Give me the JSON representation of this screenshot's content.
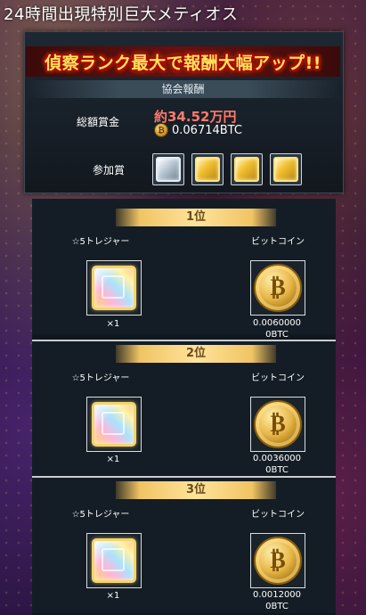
{
  "header": {
    "title": "24時間出現特別巨大メティオス"
  },
  "reward_panel": {
    "banner": "偵察ランク最大で報酬大幅アップ!!",
    "association_label": "協会報酬",
    "total_prize_label": "総額賞金",
    "total_yen": "約34.52万円",
    "total_btc": "0.06714BTC",
    "participation_label": "参加賞",
    "participation_items": [
      "silver-treasure-cube-icon",
      "gold-treasure-cube-icon",
      "gold-treasure-cube-icon",
      "gold-treasure-cube-icon"
    ]
  },
  "ranks": [
    {
      "rank": "1位",
      "item_name": "☆5トレジャー",
      "item_qty": "×1",
      "coin_name": "ビットコイン",
      "btc_amount": "0.0060000 0BTC"
    },
    {
      "rank": "2位",
      "item_name": "☆5トレジャー",
      "item_qty": "×1",
      "coin_name": "ビットコイン",
      "btc_amount": "0.0036000 0BTC"
    },
    {
      "rank": "3位",
      "item_name": "☆5トレジャー",
      "item_qty": "×1",
      "coin_name": "ビットコイン",
      "btc_amount": "0.0012000 0BTC"
    }
  ]
}
